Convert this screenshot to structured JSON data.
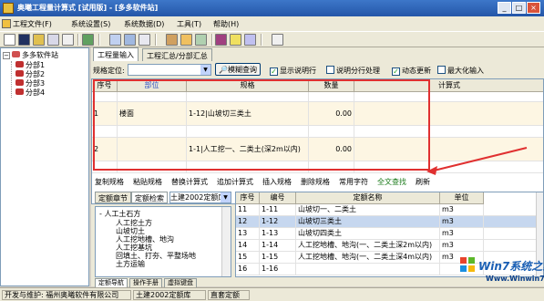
{
  "window": {
    "title": "奥曦工程量计算式 [试用版] - [多多软件站]",
    "min": "_",
    "max": "□",
    "close": "×"
  },
  "menu": [
    "工程文件(F)",
    "系统设置(S)",
    "系统数据(D)",
    "工具(T)",
    "帮助(H)"
  ],
  "tree": {
    "root": "多多软件站",
    "children": [
      "分部1",
      "分部2",
      "分部3",
      "分部4"
    ]
  },
  "tabs": [
    "工程量输入",
    "工程汇总/分部汇总"
  ],
  "filter": {
    "label": "规格定位:",
    "value": "",
    "search_button": "模糊查询",
    "checkboxes": [
      {
        "label": "显示说明行",
        "checked": true
      },
      {
        "label": "说明分行处理",
        "checked": false
      },
      {
        "label": "动态更新",
        "checked": true
      },
      {
        "label": "最大化输入",
        "checked": false
      }
    ]
  },
  "grid": {
    "columns": [
      "序号",
      "部位",
      "规格",
      "数量",
      "计算式"
    ],
    "rows": [
      {
        "no": "",
        "part": "",
        "spec": "",
        "qty": "",
        "formula": ""
      },
      {
        "no": "1",
        "part": "楼面",
        "spec": "1-12|山坡切三类土",
        "qty": "0.00",
        "formula": ""
      },
      {
        "no": "",
        "part": "",
        "spec": "",
        "qty": "",
        "formula": ""
      },
      {
        "no": "2",
        "part": "",
        "spec": "1-1|人工挖一、二类土(深2m以内)",
        "qty": "0.00",
        "formula": ""
      },
      {
        "no": "",
        "part": "",
        "spec": "",
        "qty": "",
        "formula": ""
      }
    ]
  },
  "ops": [
    "复制规格",
    "粘贴规格",
    "替换计算式",
    "追加计算式",
    "插入规格",
    "删除规格",
    "常用字符",
    "全文查找",
    "刷新"
  ],
  "quota_tabs": {
    "tabs": [
      "定额章节",
      "定额检索"
    ],
    "library": "土建2002定额库"
  },
  "chapters": [
    {
      "label": "人工土石方",
      "level": 1,
      "expander": "-"
    },
    {
      "label": "人工挖土方",
      "level": 2
    },
    {
      "label": "山坡切土",
      "level": 2
    },
    {
      "label": "人工挖地槽、地沟",
      "level": 2
    },
    {
      "label": "人工挖基坑",
      "level": 2
    },
    {
      "label": "回填土、打夯、平整场地",
      "level": 2
    },
    {
      "label": "土方运输",
      "level": 2
    }
  ],
  "quota": {
    "columns": [
      "序号",
      "编号",
      "定额名称",
      "单位"
    ],
    "rows": [
      {
        "no": "11",
        "code": "1-11",
        "name": "山坡切一、二类土",
        "unit": "m3"
      },
      {
        "no": "12",
        "code": "1-12",
        "name": "山坡切三类土",
        "unit": "m3",
        "selected": true
      },
      {
        "no": "13",
        "code": "1-13",
        "name": "山坡切四类土",
        "unit": "m3"
      },
      {
        "no": "14",
        "code": "1-14",
        "name": "人工挖地槽、地沟(一、二类土深2m以内)",
        "unit": "m3"
      },
      {
        "no": "15",
        "code": "1-15",
        "name": "人工挖地槽、地沟(一、二类土深4m以内)",
        "unit": "m3"
      },
      {
        "no": "16",
        "code": "1-16",
        "name": "",
        "unit": ""
      }
    ]
  },
  "bottom_tabs": [
    "定额导航",
    "操作手册",
    "虚拟键盘"
  ],
  "status": [
    "开发与维护: 福州奥曦软件有限公司",
    "土建2002定额库",
    "直套定额"
  ],
  "watermark": {
    "brand": "Win7系统之家",
    "url": "Www.Winwin7.com"
  }
}
